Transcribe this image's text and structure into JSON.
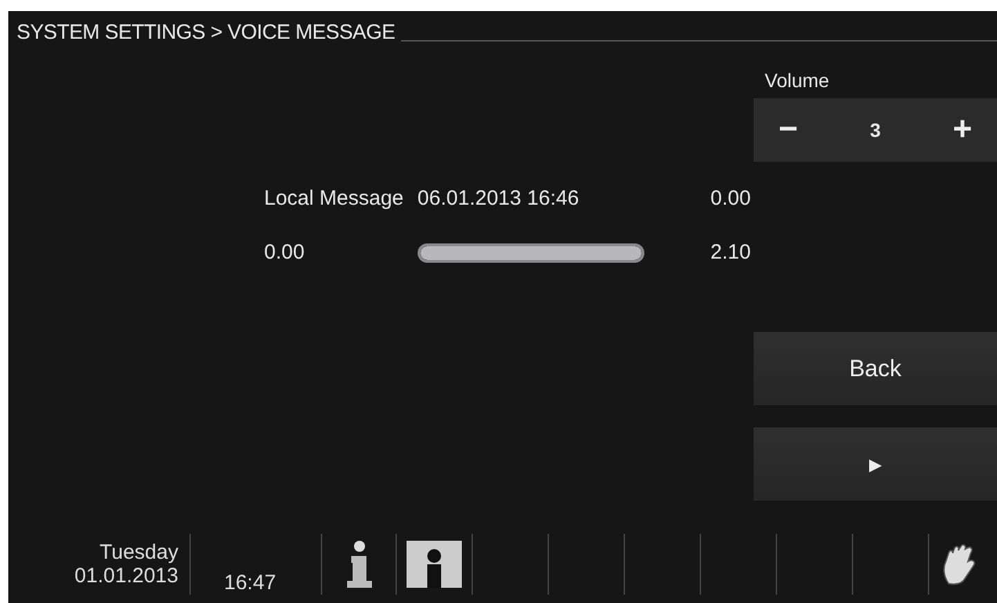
{
  "header": {
    "breadcrumb": "SYSTEM SETTINGS > VOICE MESSAGE"
  },
  "volume": {
    "label": "Volume",
    "minus": "−",
    "value": "3",
    "plus": "+"
  },
  "message": {
    "name": "Local Message",
    "timestamp": "06.01.2013 16:46",
    "reading": "0.00"
  },
  "playback": {
    "start": "0.00",
    "end": "2.10",
    "level": 1
  },
  "buttons": [
    {
      "kind": "text",
      "label": "Back"
    },
    {
      "kind": "play",
      "label": "▶"
    }
  ],
  "status_bar": {
    "day": "Tuesday",
    "date": "01.01.2013",
    "time": "16:47"
  }
}
